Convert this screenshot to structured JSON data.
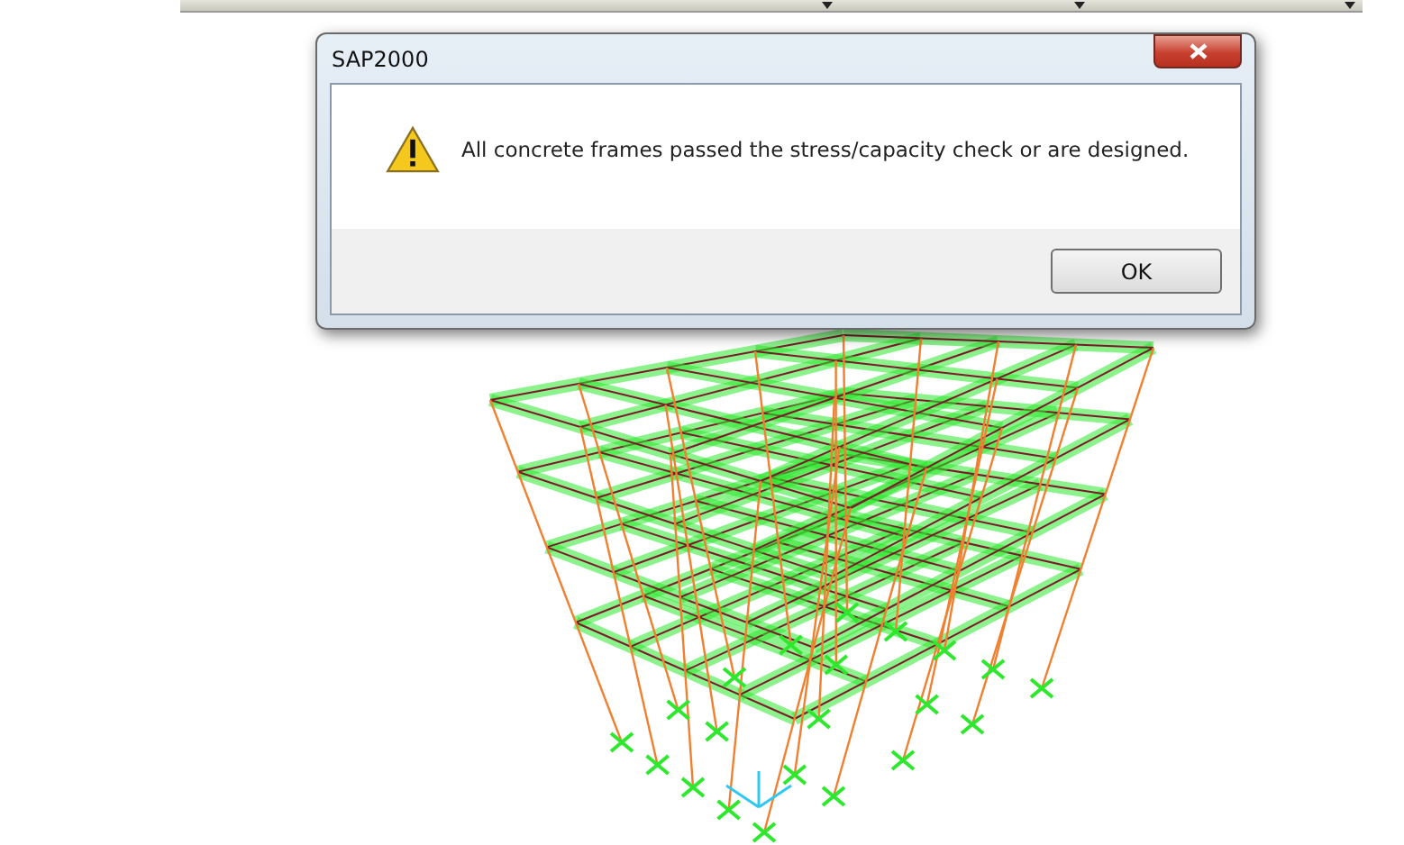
{
  "dialog": {
    "title": "SAP2000",
    "message": "All concrete frames passed the stress/capacity check or are designed.",
    "buttons": [
      {
        "label": "OK"
      }
    ]
  }
}
